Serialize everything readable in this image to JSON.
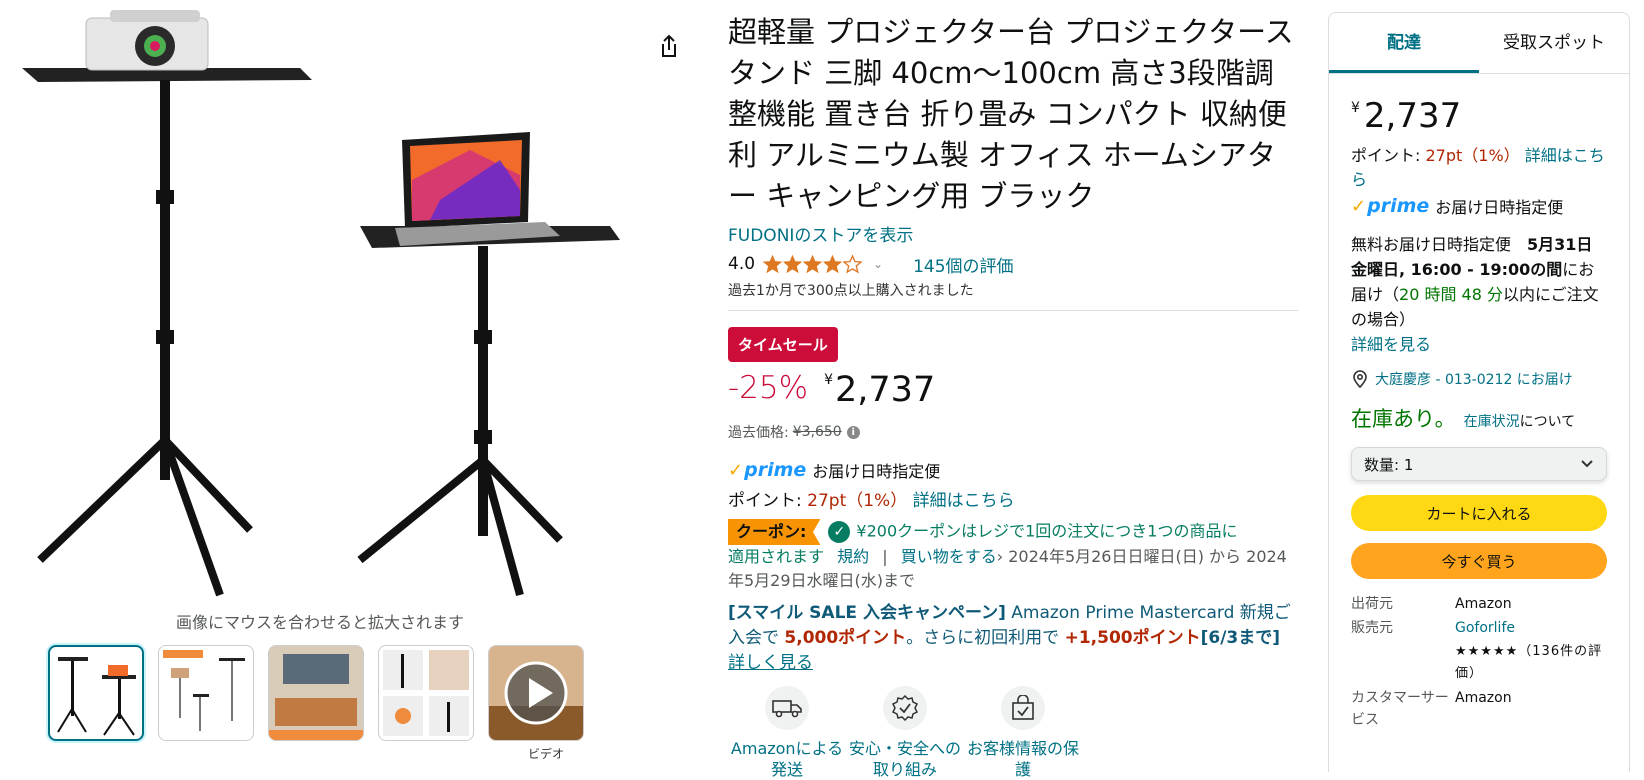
{
  "gallery": {
    "hover_hint": "画像にマウスを合わせると拡大されます",
    "video_label": "ビデオ",
    "thumbnails": [
      {
        "name": "thumbnail-1",
        "selected": true
      },
      {
        "name": "thumbnail-2",
        "selected": false
      },
      {
        "name": "thumbnail-3",
        "selected": false
      },
      {
        "name": "thumbnail-4",
        "selected": false
      },
      {
        "name": "thumbnail-video",
        "selected": false
      }
    ]
  },
  "product": {
    "title": "超軽量 プロジェクター台 プロジェクタースタンド 三脚 40cm～100cm 高さ3段階調整機能 置き台 折り畳み コンパクト 収納便利 アルミニウム製 オフィス ホームシアター キャンピング用 ブラック",
    "store_link": "FUDONIのストアを表示",
    "rating_value": "4.0",
    "rating_stars": 4.0,
    "rating_count": "145個の評価",
    "bought_text": "過去1か月で300点以上購入されました",
    "deal_badge": "タイムセール",
    "discount": "-25%",
    "currency": "¥",
    "price": "2,737",
    "list_price_label": "過去価格:",
    "list_price": "¥3,650",
    "prime_logo": "prime",
    "prime_text": "お届け日時指定便",
    "points_label": "ポイント:",
    "points_value": "27pt（1%）",
    "points_link": "詳細はこちら",
    "coupon_badge": "クーポン:",
    "coupon_text_1": "¥200クーポンはレジで1回の注文につき1つの商品に",
    "coupon_text_2": "適用されます",
    "coupon_terms": "規約",
    "coupon_sep": "|",
    "coupon_shop": "買い物をする",
    "coupon_period": "2024年5月26日日曜日(日) から 2024年5月29日水曜日(水)まで",
    "promo_bracket": "[スマイル SALE 入会キャンペーン]",
    "promo_text_1": " Amazon Prime Mastercard 新規ご入会で ",
    "promo_points_1": "5,000ポイント",
    "promo_text_2": "。さらに初回利用で ",
    "promo_points_2": "+1,500ポイント",
    "promo_date": "[6/3まで]",
    "promo_link": "詳しく見る",
    "features": [
      {
        "icon": "truck-icon",
        "label": "Amazonによる発送"
      },
      {
        "icon": "safety-badge-icon",
        "label": "安心・安全への取り組み"
      },
      {
        "icon": "secure-bag-icon",
        "label": "お客様情報の保護"
      }
    ]
  },
  "buybox": {
    "tabs": [
      "配達",
      "受取スポット"
    ],
    "currency": "¥",
    "price": "2,737",
    "points_label": "ポイント:",
    "points_value": "27pt（1%）",
    "points_link": "詳細はこちら",
    "prime_logo": "prime",
    "prime_text": "お届け日時指定便",
    "delivery_prefix": "無料お届け日時指定便　",
    "delivery_date": "5月31日 金曜日, 16:00 - 19:00の間",
    "delivery_mid": "にお届け（",
    "delivery_countdown": "20 時間 48 分",
    "delivery_suffix": "以内にご注文の場合）",
    "delivery_link": "詳細を見る",
    "location": "大庭慶彦 - 013-0212 にお届け",
    "stock": "在庫あり。",
    "stock_link": "在庫状況",
    "stock_suffix": "について",
    "qty_label": "数量: 1",
    "add_to_cart": "カートに入れる",
    "buy_now": "今すぐ買う",
    "seller_rows": [
      {
        "key": "出荷元",
        "value": "Amazon"
      },
      {
        "key": "販売元",
        "value": "Goforlife"
      },
      {
        "key": "",
        "value": "★★★★★（136件の評価）"
      },
      {
        "key": "カスタマーサービス",
        "value": "Amazon"
      }
    ]
  },
  "colors": {
    "accent_link": "#007185",
    "deal_red": "#cc0c39",
    "price_red": "#b12704",
    "star_orange": "#de7921",
    "cart_yellow": "#ffd814",
    "buy_orange": "#ffa41c",
    "stock_green": "#007600"
  }
}
